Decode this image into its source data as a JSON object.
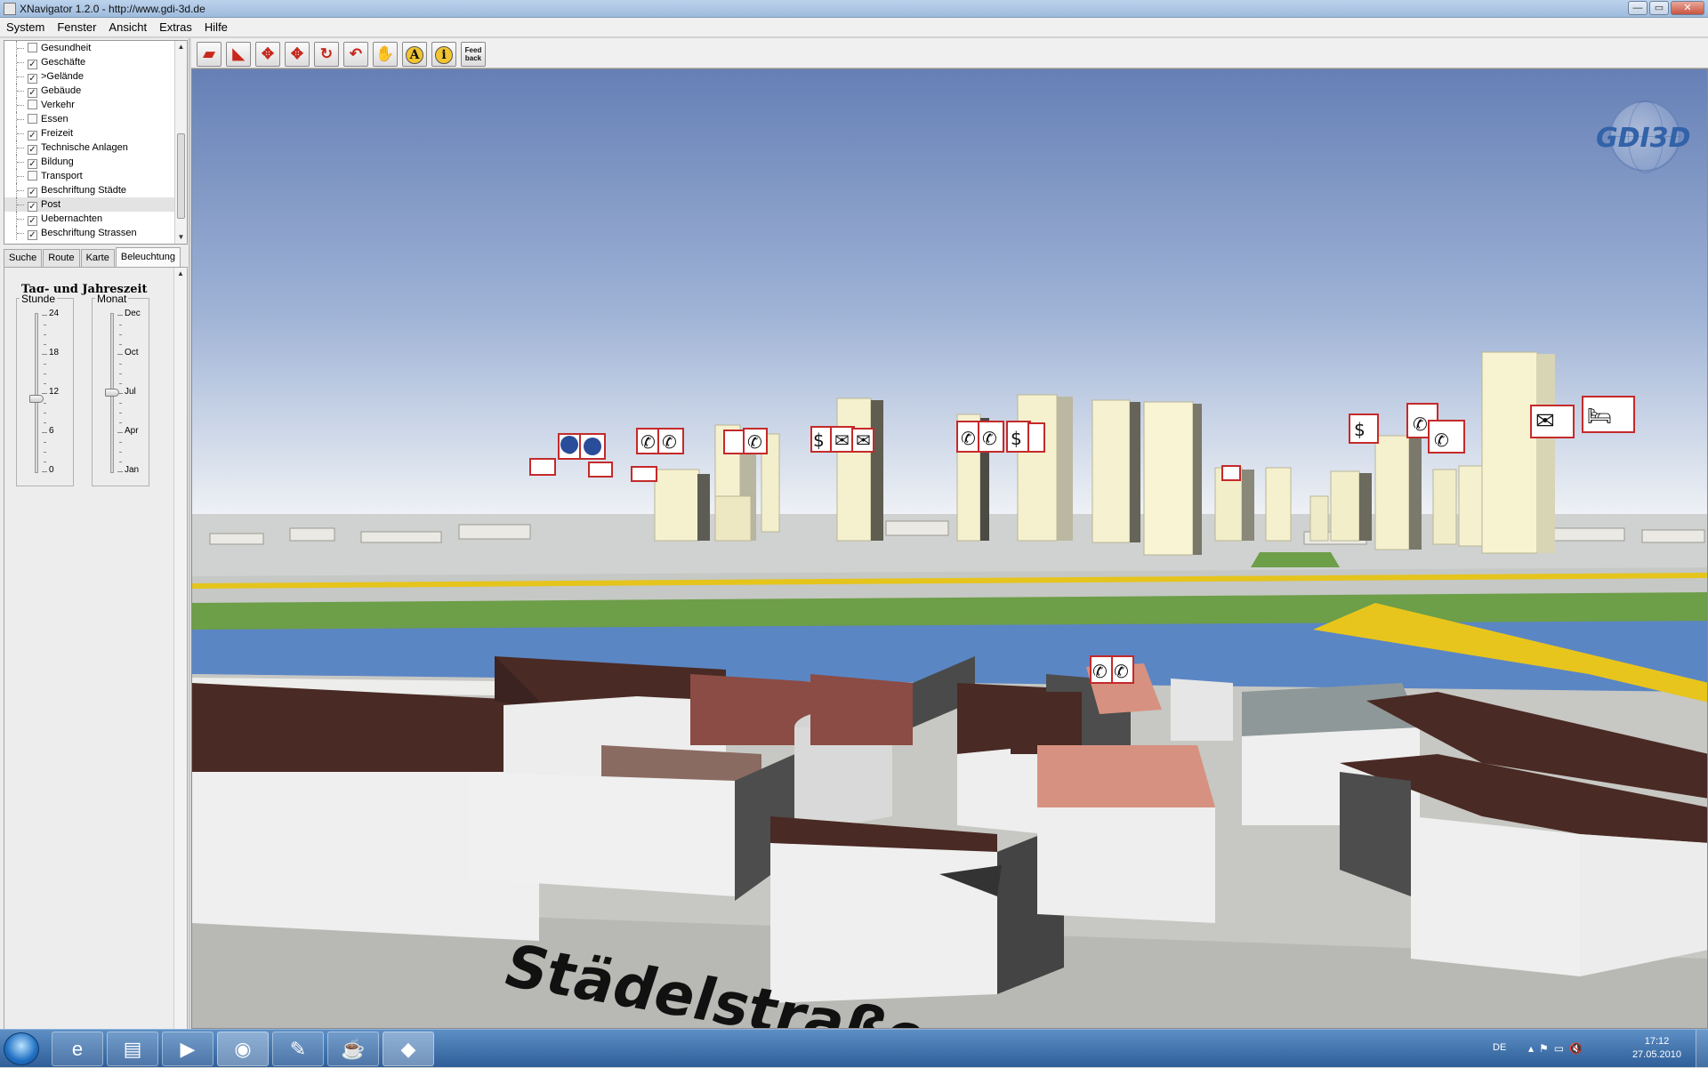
{
  "window": {
    "title": "XNavigator 1.2.0 - http://www.gdi-3d.de",
    "btn_minimize": "—",
    "btn_maximize": "▭",
    "btn_close": "✕"
  },
  "menu": [
    "System",
    "Fenster",
    "Ansicht",
    "Extras",
    "Hilfe"
  ],
  "layers": [
    {
      "label": "Gesundheit",
      "checked": false
    },
    {
      "label": "Geschäfte",
      "checked": true
    },
    {
      "label": ">Gelände",
      "checked": true
    },
    {
      "label": "Gebäude",
      "checked": true
    },
    {
      "label": "Verkehr",
      "checked": false
    },
    {
      "label": "Essen",
      "checked": false
    },
    {
      "label": "Freizeit",
      "checked": true
    },
    {
      "label": "Technische Anlagen",
      "checked": true
    },
    {
      "label": "Bildung",
      "checked": true
    },
    {
      "label": "Transport",
      "checked": false
    },
    {
      "label": "Beschriftung Städte",
      "checked": true
    },
    {
      "label": "Post",
      "checked": true,
      "selected": true
    },
    {
      "label": "Uebernachten",
      "checked": true
    },
    {
      "label": "Beschriftung Strassen",
      "checked": true
    }
  ],
  "tabs": [
    "Suche",
    "Route",
    "Karte",
    "Beleuchtung"
  ],
  "active_tab": "Beleuchtung",
  "lighting": {
    "title": "Tag- und Jahreszeit",
    "hour_label": "Stunde",
    "hour_ticks": [
      "24",
      "18",
      "12",
      "6",
      "0"
    ],
    "hour_value": 11,
    "month_label": "Monat",
    "month_ticks": [
      "Dec",
      "Oct",
      "Jul",
      "Apr",
      "Jan"
    ],
    "month_value": "Jul"
  },
  "toolbar": {
    "tools": [
      {
        "name": "tool-pan-map",
        "glyph": "▰"
      },
      {
        "name": "tool-rotate-view",
        "glyph": "◣"
      },
      {
        "name": "tool-navigate",
        "glyph": "✥"
      },
      {
        "name": "tool-move",
        "glyph": "✥"
      },
      {
        "name": "tool-orbit",
        "glyph": "↻"
      },
      {
        "name": "tool-back",
        "glyph": "↶"
      },
      {
        "name": "tool-hand",
        "glyph": "✋"
      },
      {
        "name": "tool-annotate",
        "glyph": "A"
      },
      {
        "name": "tool-info",
        "glyph": "i"
      },
      {
        "name": "tool-feedback",
        "glyph": "Feed back"
      }
    ]
  },
  "viewport": {
    "logo_text": "GDI3D",
    "street_label": "Städelstraße"
  },
  "taskbar": {
    "language": "DE",
    "time": "17:12",
    "date": "27.05.2010",
    "apps": [
      "windows-explorer-ie",
      "file-explorer",
      "media-player",
      "firefox",
      "paint",
      "java",
      "xnavigator"
    ]
  },
  "colors": {
    "sky_top": "#6b84b8",
    "sky_bottom": "#e9eef4",
    "river": "#5a86c4",
    "grass": "#6fa04a",
    "road": "#e9c81b",
    "roof_brown": "#4a2a24",
    "roof_pink": "#d79180"
  }
}
